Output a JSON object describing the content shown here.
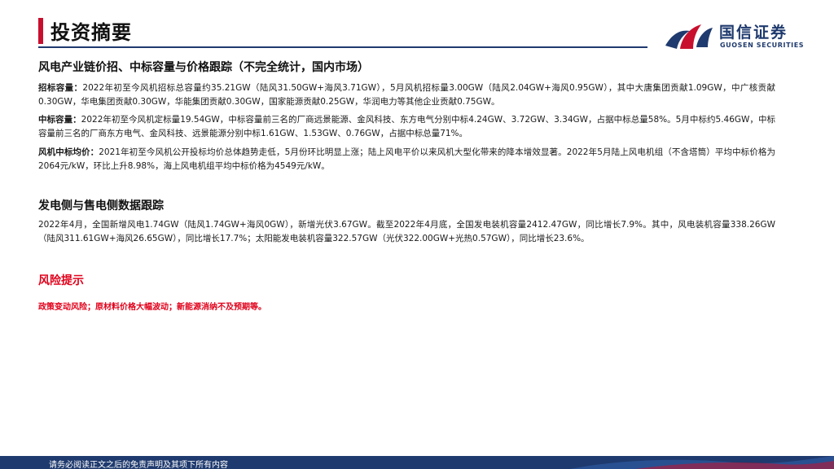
{
  "header": {
    "title": "投资摘要",
    "logo_cn": "国信证券",
    "logo_en": "GUOSEN SECURITIES",
    "accent_color": "#c8102e",
    "brand_color": "#1f3a6e"
  },
  "section1": {
    "title": "风电产业链价招、中标容量与价格跟踪（不完全统计，国内市场）",
    "p1_label": "招标容量：",
    "p1_text": "2022年初至今风机招标总容量约35.21GW（陆风31.50GW+海风3.71GW），5月风机招标量3.00GW（陆风2.04GW+海风0.95GW），其中大唐集团贡献1.09GW，中广核贡献0.30GW，华电集团贡献0.30GW，华能集团贡献0.30GW，国家能源贡献0.25GW，华润电力等其他企业贡献0.75GW。",
    "p2_label": "中标容量：",
    "p2_text": "2022年初至今风机定标量19.54GW，中标容量前三名的厂商远景能源、金风科技、东方电气分别中标4.24GW、3.72GW、3.34GW，占据中标总量58%。5月中标约5.46GW，中标容量前三名的厂商东方电气、金风科技、远景能源分别中标1.61GW、1.53GW、0.76GW，占据中标总量71%。",
    "p3_label": "风机中标均价：",
    "p3_text": "2021年初至今风机公开投标均价总体趋势走低，5月份环比明显上涨；陆上风电平价以来风机大型化带来的降本增效显著。2022年5月陆上风电机组（不含塔筒）平均中标价格为2064元/kW，环比上升8.98%，海上风电机组平均中标价格为4549元/kW。"
  },
  "section2": {
    "title": "发电侧与售电侧数据跟踪",
    "p1_text": "2022年4月，全国新增风电1.74GW（陆风1.74GW+海风0GW），新增光伏3.67GW。截至2022年4月底，全国发电装机容量2412.47GW，同比增长7.9%。其中，风电装机容量338.26GW（陆风311.61GW+海风26.65GW），同比增长17.7%；太阳能发电装机容量322.57GW（光伏322.00GW+光热0.57GW），同比增长23.6%。"
  },
  "section3": {
    "title": "风险提示",
    "text": "政策变动风险；原材料价格大幅波动；新能源消纳不及预期等。",
    "color": "#e0001a"
  },
  "footer": {
    "text": "请务必阅读正文之后的免责声明及其项下所有内容"
  }
}
